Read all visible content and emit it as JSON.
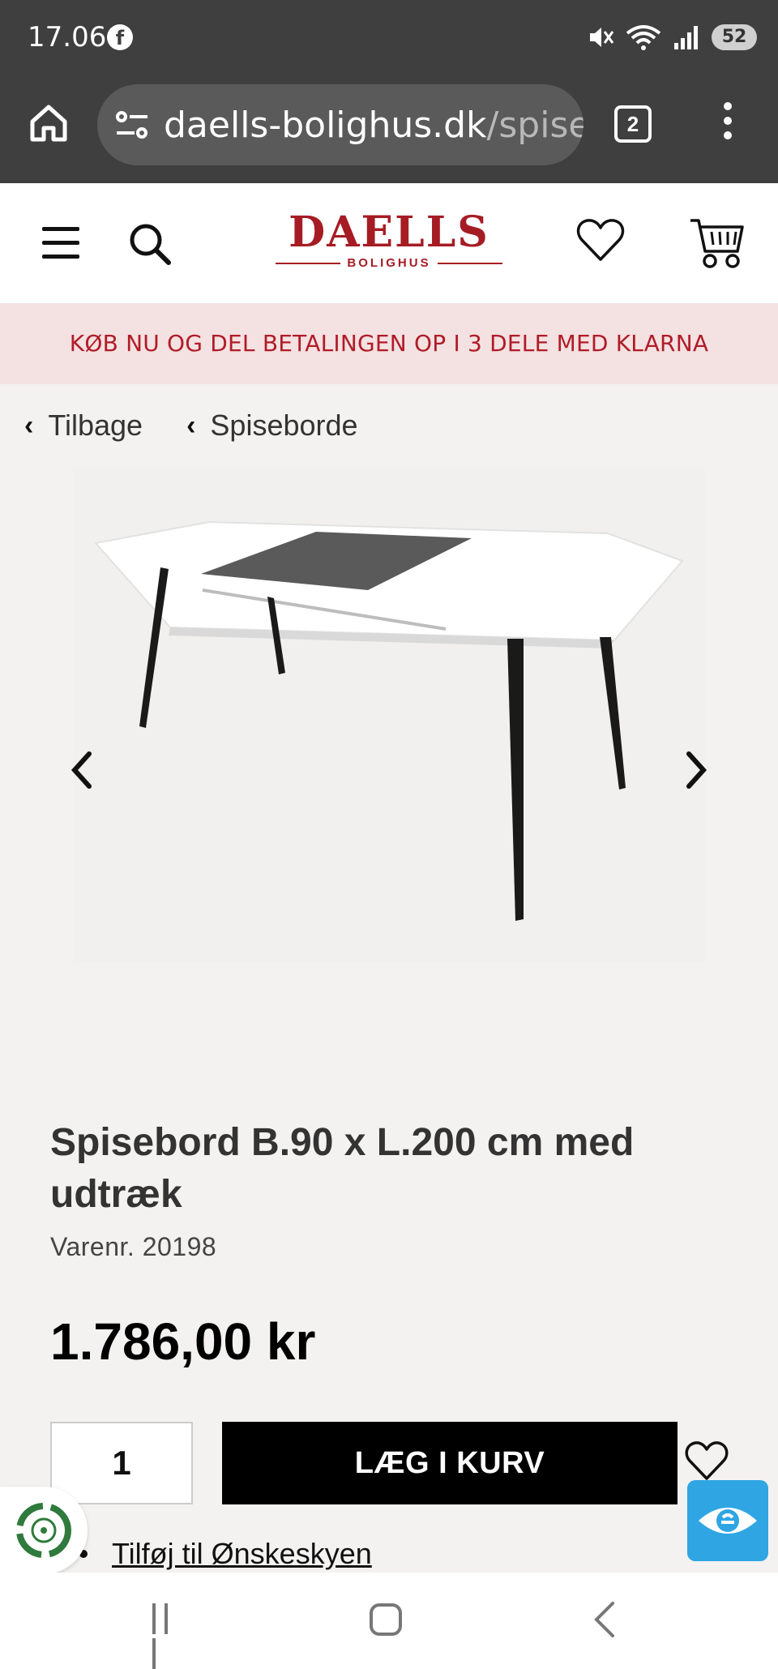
{
  "status_bar": {
    "time": "17.06",
    "app_icon": "facebook-icon",
    "indicators": [
      "mute-icon",
      "wifi-icon",
      "signal-icon"
    ],
    "battery": "52"
  },
  "browser": {
    "url_host": "daells-bolighus.dk",
    "url_path": "/spise",
    "tab_count": "2"
  },
  "site": {
    "logo_main": "DAELLS",
    "logo_sub": "BOLIGHUS",
    "banner": "KØB NU OG DEL BETALINGEN OP I 3 DELE MED KLARNA",
    "brand_color": "#a61c24"
  },
  "breadcrumbs": [
    {
      "label": "Tilbage"
    },
    {
      "label": "Spiseborde"
    }
  ],
  "product": {
    "title": "Spisebord B.90 x L.200 cm med udtræk",
    "sku": "Varenr. 20198",
    "price": "1.786,00 kr",
    "quantity": "1",
    "add_to_cart": "LÆG I KURV",
    "wishlist_link": "Tilføj til Ønskeskyen"
  },
  "icons": {
    "accessibility": "accessibility-eye-icon",
    "eco": "eco-badge-icon"
  }
}
